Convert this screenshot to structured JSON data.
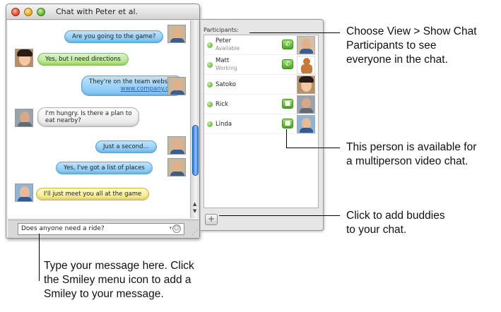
{
  "window": {
    "title": "Chat with Peter et al."
  },
  "messages": [
    {
      "text": "Are you going to the game?",
      "style": "blue",
      "side": "right"
    },
    {
      "text": "Yes, but I need directions",
      "style": "green",
      "side": "left"
    },
    {
      "line1": "They're on the team website",
      "link": "www.company.org",
      "style": "blue",
      "side": "right"
    },
    {
      "line1": "I'm hungry. Is there a plan to",
      "line2": "eat nearby?",
      "style": "gray",
      "side": "left"
    },
    {
      "text": "Just a second...",
      "style": "blue",
      "side": "right"
    },
    {
      "text": "Yes, I've got a list of places",
      "style": "blue",
      "side": "right"
    },
    {
      "text": "I'll just meet you all at the game",
      "style": "yellow",
      "side": "left"
    }
  ],
  "input": {
    "value": "Does anyone need a ride?"
  },
  "participants": {
    "header": "Participants:",
    "people": [
      {
        "name": "Peter",
        "status": "Available",
        "icon": "phone-icon"
      },
      {
        "name": "Matt",
        "status": "Working",
        "icon": "phone-icon"
      },
      {
        "name": "Satoko",
        "status": "",
        "icon": ""
      },
      {
        "name": "Rick",
        "status": "",
        "icon": "video-camera-icon"
      },
      {
        "name": "Linda",
        "status": "",
        "icon": "video-camera-icon"
      }
    ],
    "add_label": "+"
  },
  "callouts": {
    "participants": [
      "Choose View > Show Chat",
      "Participants to see",
      "everyone in the chat."
    ],
    "video": [
      "This person is available for",
      "a multiperson video chat."
    ],
    "add": [
      "Click to add buddies",
      "to your chat."
    ],
    "message": [
      "Type your message here. Click",
      "the Smiley menu icon to add a",
      "Smiley to your message."
    ]
  },
  "colors": {
    "bubble_blue": "#7cc4f5",
    "bubble_green": "#a8e07e",
    "bubble_yellow": "#f4e57a",
    "available_green": "#4a9e27"
  }
}
